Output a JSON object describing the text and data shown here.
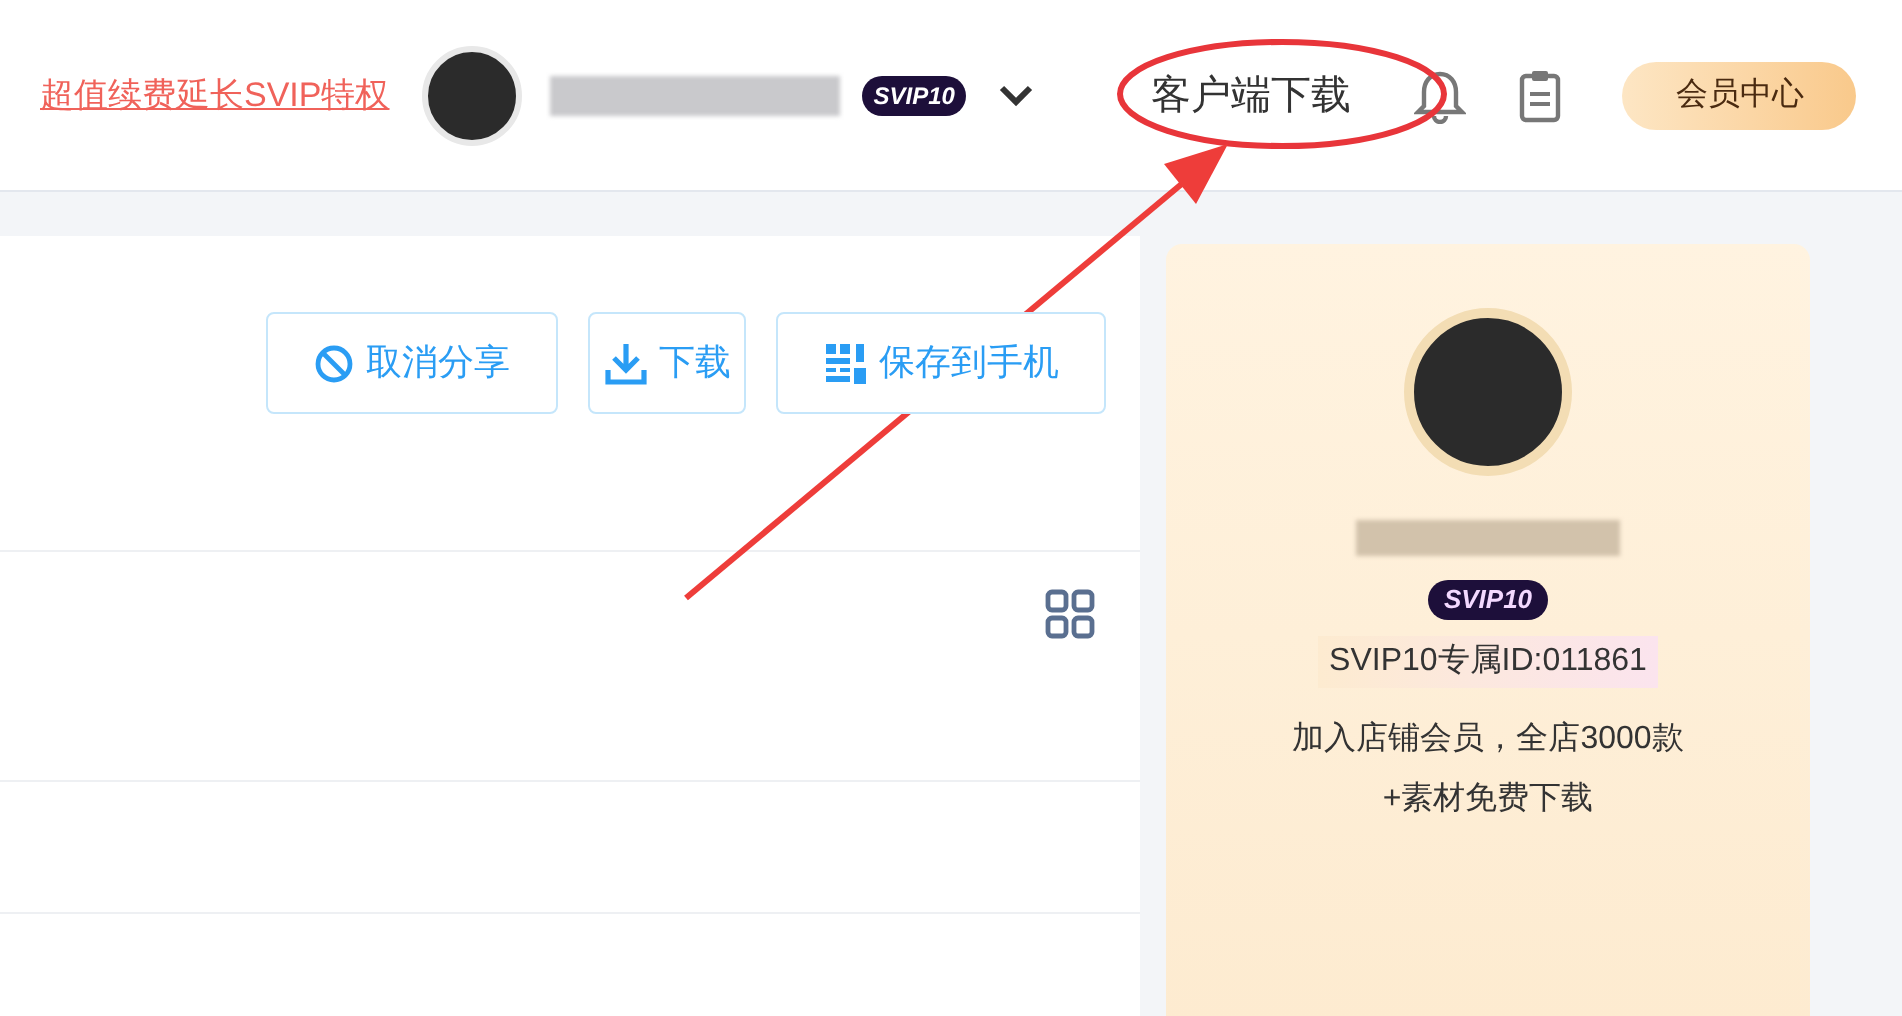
{
  "header": {
    "promo_link": "超值续费延长SVIP特权",
    "user_badge": "SVIP10",
    "client_download": "客户端下载",
    "member_center": "会员中心"
  },
  "toolbar": {
    "buttons": [
      {
        "kind": "cancel-share",
        "label": "取消分享"
      },
      {
        "kind": "download",
        "label": "下载"
      },
      {
        "kind": "save-phone",
        "label": "保存到手机"
      }
    ]
  },
  "member_card": {
    "badge": "SVIP10",
    "member_id": "SVIP10专属ID:011861",
    "offer_lines": [
      "加入店铺会员，全店3000款",
      "+素材免费下载"
    ]
  }
}
